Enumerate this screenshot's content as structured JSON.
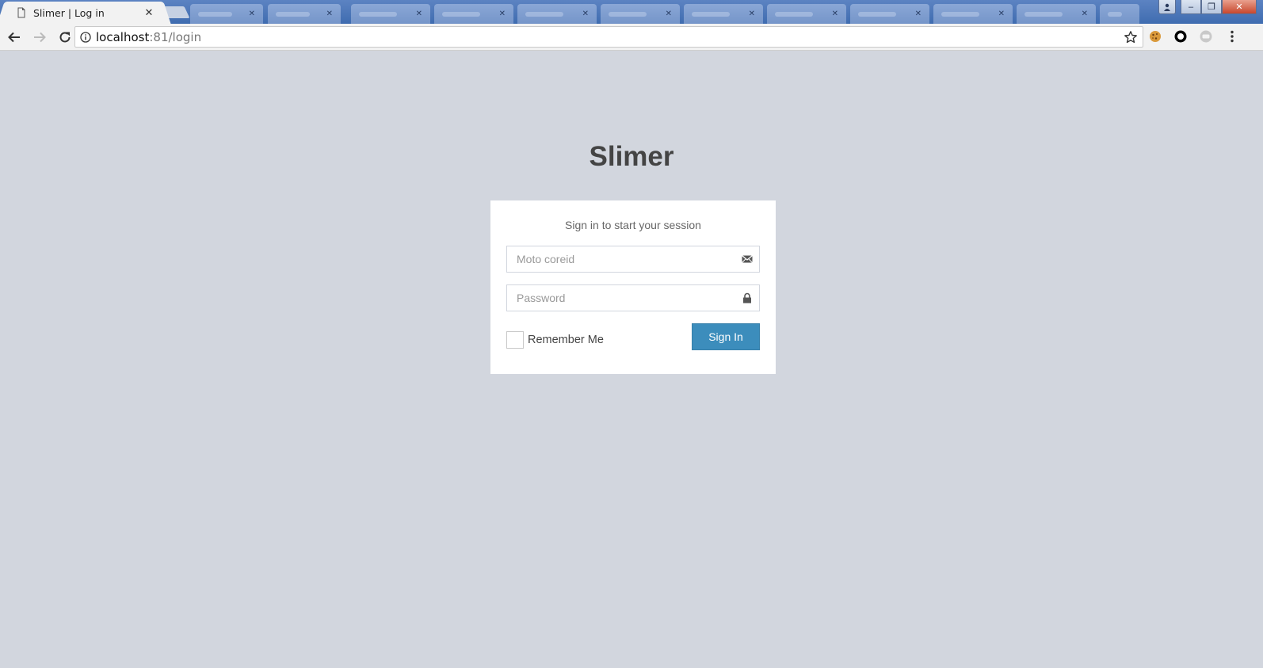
{
  "browser": {
    "active_tab": {
      "title": "Slimer | Log in",
      "close": "✕"
    },
    "window_controls": {
      "minimize": "–",
      "restore": "❐",
      "close": "✕"
    },
    "url": {
      "host": "localhost",
      "rest": ":81/login"
    }
  },
  "page": {
    "logo": "Slimer",
    "login_message": "Sign in to start your session",
    "form": {
      "coreid_placeholder": "Moto coreid",
      "password_placeholder": "Password",
      "remember_label": "Remember Me",
      "submit_label": "Sign In"
    }
  },
  "colors": {
    "background": "#d2d6de",
    "primary": "#3c8dbc"
  }
}
